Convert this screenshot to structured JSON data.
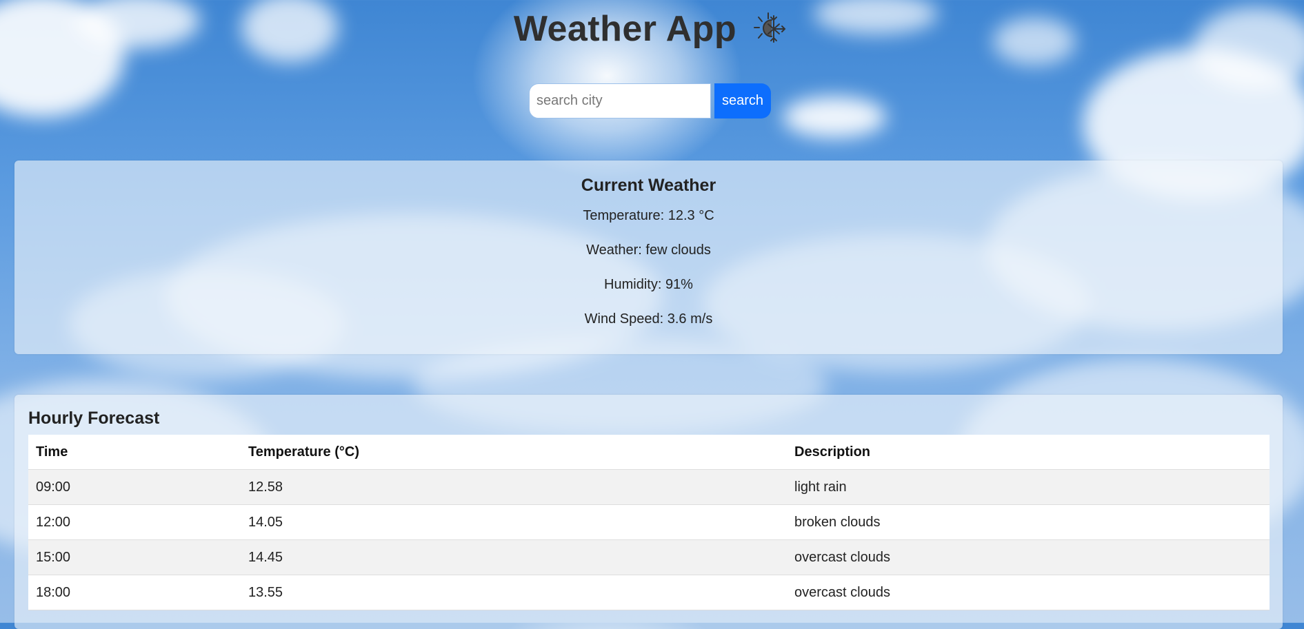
{
  "header": {
    "title": "Weather App",
    "icon": "sun-snowflake-icon"
  },
  "search": {
    "placeholder": "search city",
    "value": "",
    "button_label": "search"
  },
  "current": {
    "title": "Current Weather",
    "temperature": "Temperature: 12.3 °C",
    "weather": "Weather: few clouds",
    "humidity": "Humidity: 91%",
    "wind": "Wind Speed: 3.6 m/s"
  },
  "hourly": {
    "title": "Hourly Forecast",
    "columns": [
      "Time",
      "Temperature (°C)",
      "Description"
    ],
    "rows": [
      [
        "09:00",
        "12.58",
        "light rain"
      ],
      [
        "12:00",
        "14.05",
        "broken clouds"
      ],
      [
        "15:00",
        "14.45",
        "overcast clouds"
      ],
      [
        "18:00",
        "13.55",
        "overcast clouds"
      ]
    ]
  },
  "colors": {
    "accent": "#0d6efd",
    "sky": "#5b9be0",
    "title": "#2f2f2f"
  }
}
